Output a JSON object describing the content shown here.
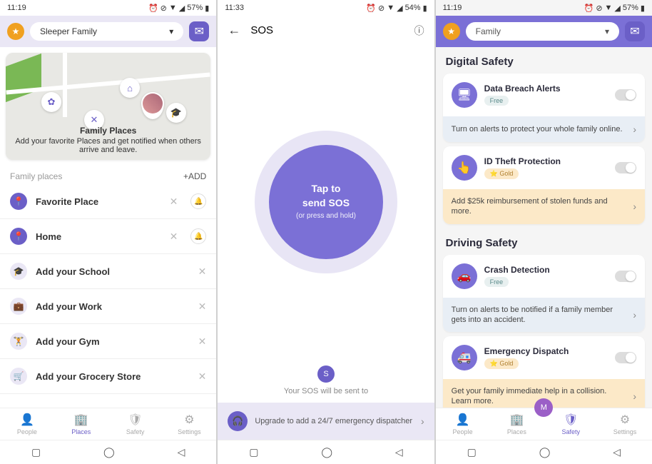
{
  "status": {
    "time1": "11:19",
    "time2": "11:33",
    "time3": "11:19",
    "battery1": "57%",
    "battery2": "54%",
    "battery3": "57%"
  },
  "screen1": {
    "family": "Sleeper Family",
    "map": {
      "title": "Family Places",
      "subtitle": "Add your favorite Places and get notified when others arrive and leave."
    },
    "section": {
      "label": "Family places",
      "add": "+ADD"
    },
    "places": [
      {
        "icon": "📍",
        "label": "Favorite Place",
        "filled": true,
        "bell": true
      },
      {
        "icon": "📍",
        "label": "Home",
        "filled": true,
        "bell": true
      },
      {
        "icon": "🎓",
        "label": "Add your School",
        "filled": false
      },
      {
        "icon": "💼",
        "label": "Add your Work",
        "filled": false
      },
      {
        "icon": "🏋",
        "label": "Add your Gym",
        "filled": false
      },
      {
        "icon": "🛒",
        "label": "Add your Grocery Store",
        "filled": false
      }
    ],
    "nav": [
      {
        "icon": "👤",
        "label": "People"
      },
      {
        "icon": "🏢",
        "label": "Places"
      },
      {
        "icon": "🛡",
        "label": "Safety"
      },
      {
        "icon": "⚙",
        "label": "Settings"
      }
    ]
  },
  "screen2": {
    "title": "SOS",
    "button": {
      "line1": "Tap to",
      "line2": "send SOS",
      "sub": "(or press and hold)"
    },
    "avatar_letter": "S",
    "sent_text": "Your SOS will be sent to",
    "upgrade": "Upgrade to add a 24/7 emergency dispatcher"
  },
  "screen3": {
    "family": "Family",
    "sections": {
      "digital": "Digital Safety",
      "driving": "Driving Safety"
    },
    "cards": [
      {
        "icon": "🖥",
        "title": "Data Breach Alerts",
        "badge": "Free",
        "badge_type": "free",
        "banner": "Turn on alerts to protect your whole family online.",
        "banner_type": "blue"
      },
      {
        "icon": "👆",
        "title": "ID Theft Protection",
        "badge": "⭐ Gold",
        "badge_type": "gold",
        "banner": "Add $25k reimbursement of stolen funds and more.",
        "banner_type": "gold"
      },
      {
        "icon": "🚗",
        "title": "Crash Detection",
        "badge": "Free",
        "badge_type": "free",
        "banner": "Turn on alerts to be notified if a family member gets into an accident.",
        "banner_type": "blue"
      },
      {
        "icon": "🚑",
        "title": "Emergency Dispatch",
        "badge": "⭐ Gold",
        "badge_type": "gold",
        "banner": "Get your family immediate help in a collision. Learn more.",
        "banner_type": "gold"
      }
    ],
    "float_letter": "M",
    "nav": [
      {
        "icon": "👤",
        "label": "People"
      },
      {
        "icon": "🏢",
        "label": "Places"
      },
      {
        "icon": "🛡",
        "label": "Safety"
      },
      {
        "icon": "⚙",
        "label": "Settings"
      }
    ]
  }
}
